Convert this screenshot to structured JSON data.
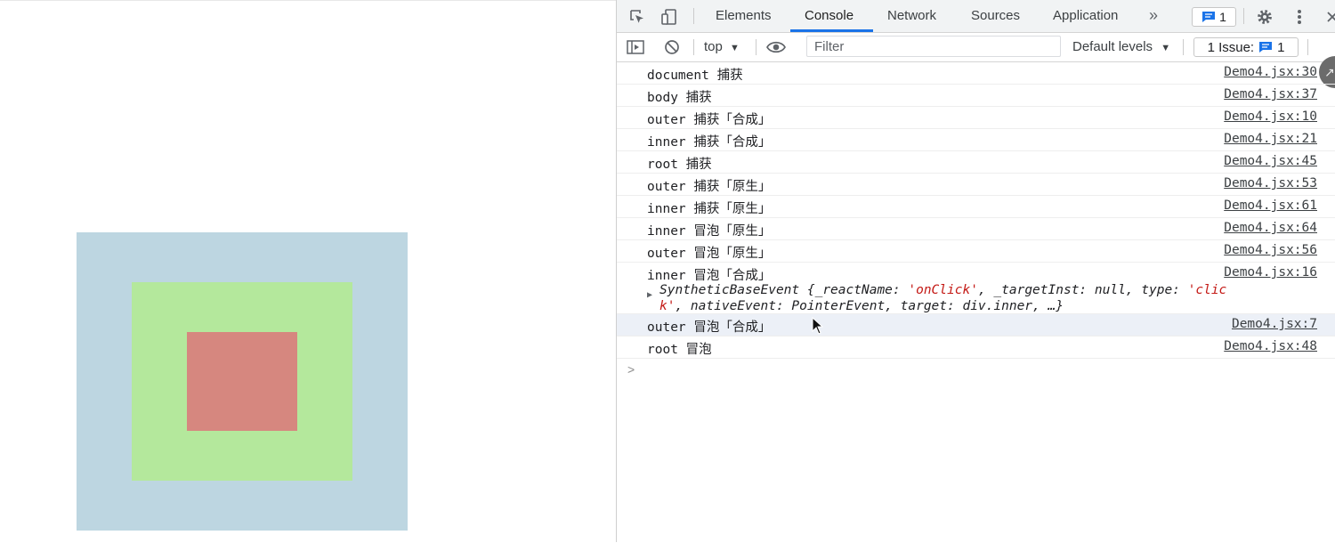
{
  "devtools": {
    "tabs": [
      {
        "label": "Elements",
        "active": false
      },
      {
        "label": "Console",
        "active": true
      },
      {
        "label": "Network",
        "active": false
      },
      {
        "label": "Sources",
        "active": false
      },
      {
        "label": "Application",
        "active": false
      }
    ],
    "overflow_label": "»",
    "messages_count": "1",
    "toolbar": {
      "context": "top",
      "filter_placeholder": "Filter",
      "levels": "Default levels",
      "issues_label": "1 Issue:",
      "issues_count": "1"
    }
  },
  "console": {
    "rows": [
      {
        "text": "document 捕获",
        "source": "Demo4.jsx:30"
      },
      {
        "text": "body 捕获",
        "source": "Demo4.jsx:37"
      },
      {
        "text": "outer 捕获「合成」",
        "source": "Demo4.jsx:10"
      },
      {
        "text": "inner 捕获「合成」",
        "source": "Demo4.jsx:21"
      },
      {
        "text": "root 捕获",
        "source": "Demo4.jsx:45"
      },
      {
        "text": "outer 捕获「原生」",
        "source": "Demo4.jsx:53"
      },
      {
        "text": "inner 捕获「原生」",
        "source": "Demo4.jsx:61"
      },
      {
        "text": "inner 冒泡「原生」",
        "source": "Demo4.jsx:64"
      },
      {
        "text": "outer 冒泡「原生」",
        "source": "Demo4.jsx:56"
      },
      {
        "text": "inner 冒泡「合成」",
        "source": "Demo4.jsx:16"
      },
      {
        "text": "outer 冒泡「合成」",
        "source": "Demo4.jsx:7"
      },
      {
        "text": "root 冒泡",
        "source": "Demo4.jsx:48"
      }
    ],
    "event_object": {
      "class_name": "SyntheticBaseEvent",
      "p1": " {_reactName: ",
      "s1": "'onClick'",
      "p2": ", _targetInst: null, type: ",
      "s2a": "'clic",
      "s2b": "k'",
      "p3": ", nativeEvent: PointerEvent, target: div.inner, …}"
    },
    "prompt": ">"
  },
  "preview": {
    "colors": {
      "outer": "#bdd6e1",
      "middle": "#b4e89c",
      "inner": "#d6877f"
    }
  },
  "colors": {
    "accent": "#1a73e8",
    "string": "#c41a16"
  }
}
